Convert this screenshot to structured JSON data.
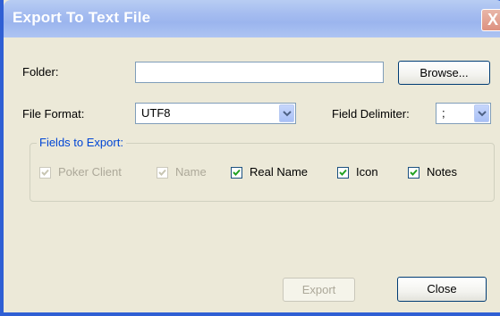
{
  "dialog": {
    "title": "Export To Text File",
    "close_glyph": "X"
  },
  "folder": {
    "label": "Folder:",
    "value": "",
    "browse_label": "Browse..."
  },
  "file_format": {
    "label": "File Format:",
    "selected": "UTF8"
  },
  "field_delimiter": {
    "label": "Field Delimiter:",
    "selected": ";"
  },
  "fields_group": {
    "legend": "Fields to Export:",
    "fields": [
      {
        "label": "Poker Client",
        "checked": true,
        "enabled": false
      },
      {
        "label": "Name",
        "checked": true,
        "enabled": false
      },
      {
        "label": "Real Name",
        "checked": true,
        "enabled": true
      },
      {
        "label": "Icon",
        "checked": true,
        "enabled": true
      },
      {
        "label": "Notes",
        "checked": true,
        "enabled": true
      }
    ]
  },
  "actions": {
    "export_label": "Export",
    "export_enabled": false,
    "close_label": "Close"
  },
  "colors": {
    "titlebar": "#a6bdf0",
    "frame": "#2f5fd4",
    "dialog_bg": "#ece9d8",
    "group_legend": "#0046d5",
    "check_mark": "#21a121"
  },
  "icons": {
    "dropdown": "chevron-down-icon",
    "check": "check-icon"
  }
}
